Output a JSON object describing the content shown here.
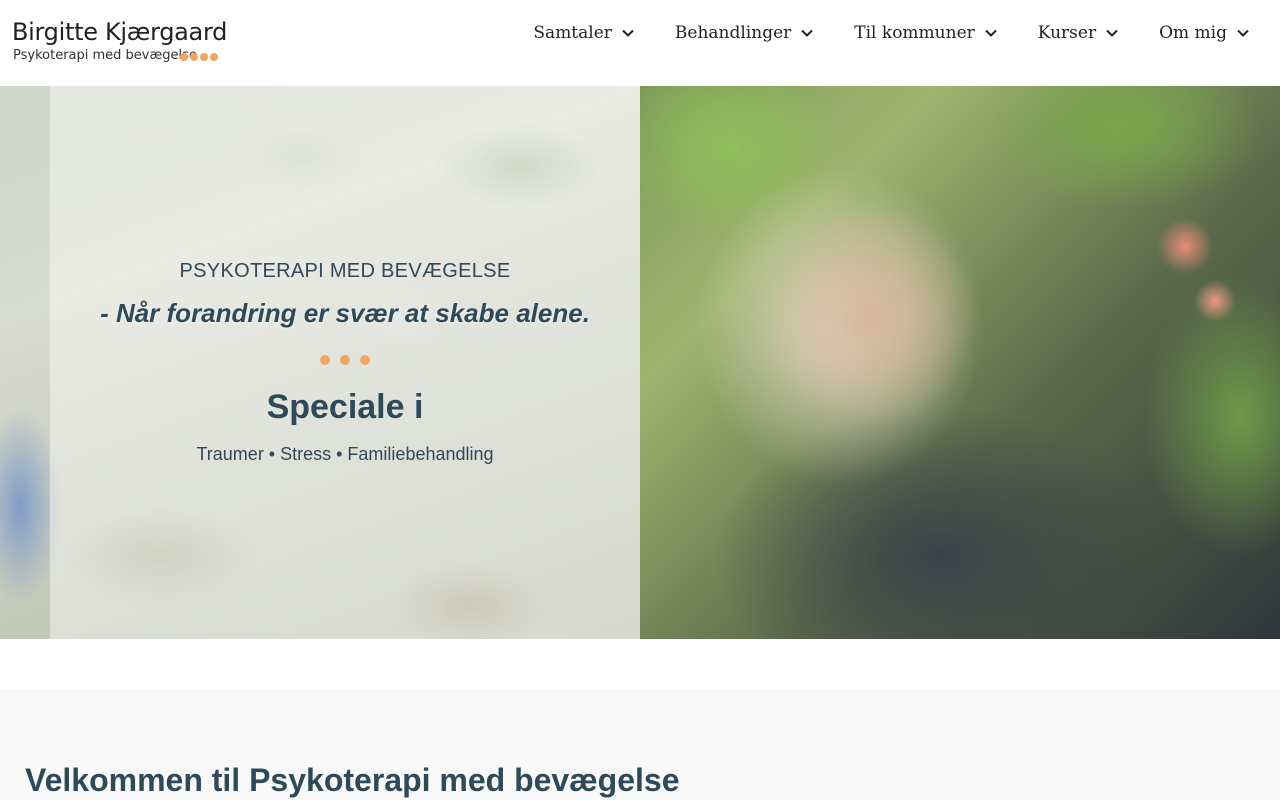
{
  "header": {
    "logo_name": "Birgitte Kjærgaard",
    "logo_tagline": "Psykoterapi med bevægelse",
    "logo_dot_color": "#f2a460",
    "nav": [
      {
        "label": "Samtaler",
        "icon": "chevron-down-icon"
      },
      {
        "label": "Behandlinger",
        "icon": "chevron-down-icon"
      },
      {
        "label": "Til kommuner",
        "icon": "chevron-down-icon"
      },
      {
        "label": "Kurser",
        "icon": "chevron-down-icon"
      },
      {
        "label": "Om mig",
        "icon": "chevron-down-icon"
      }
    ]
  },
  "hero": {
    "eyebrow": "PSYKOTERAPI MED BEVÆGELSE",
    "tagline": "- Når forandring er svær at skabe alene.",
    "specialty_heading": "Speciale i",
    "specialty_areas": "Traumer • Stress • Familiebehandling",
    "accent_color": "#f2a460",
    "text_color": "#2e4a5a"
  },
  "welcome": {
    "title": "Velkommen til Psykoterapi med bevægelse"
  }
}
